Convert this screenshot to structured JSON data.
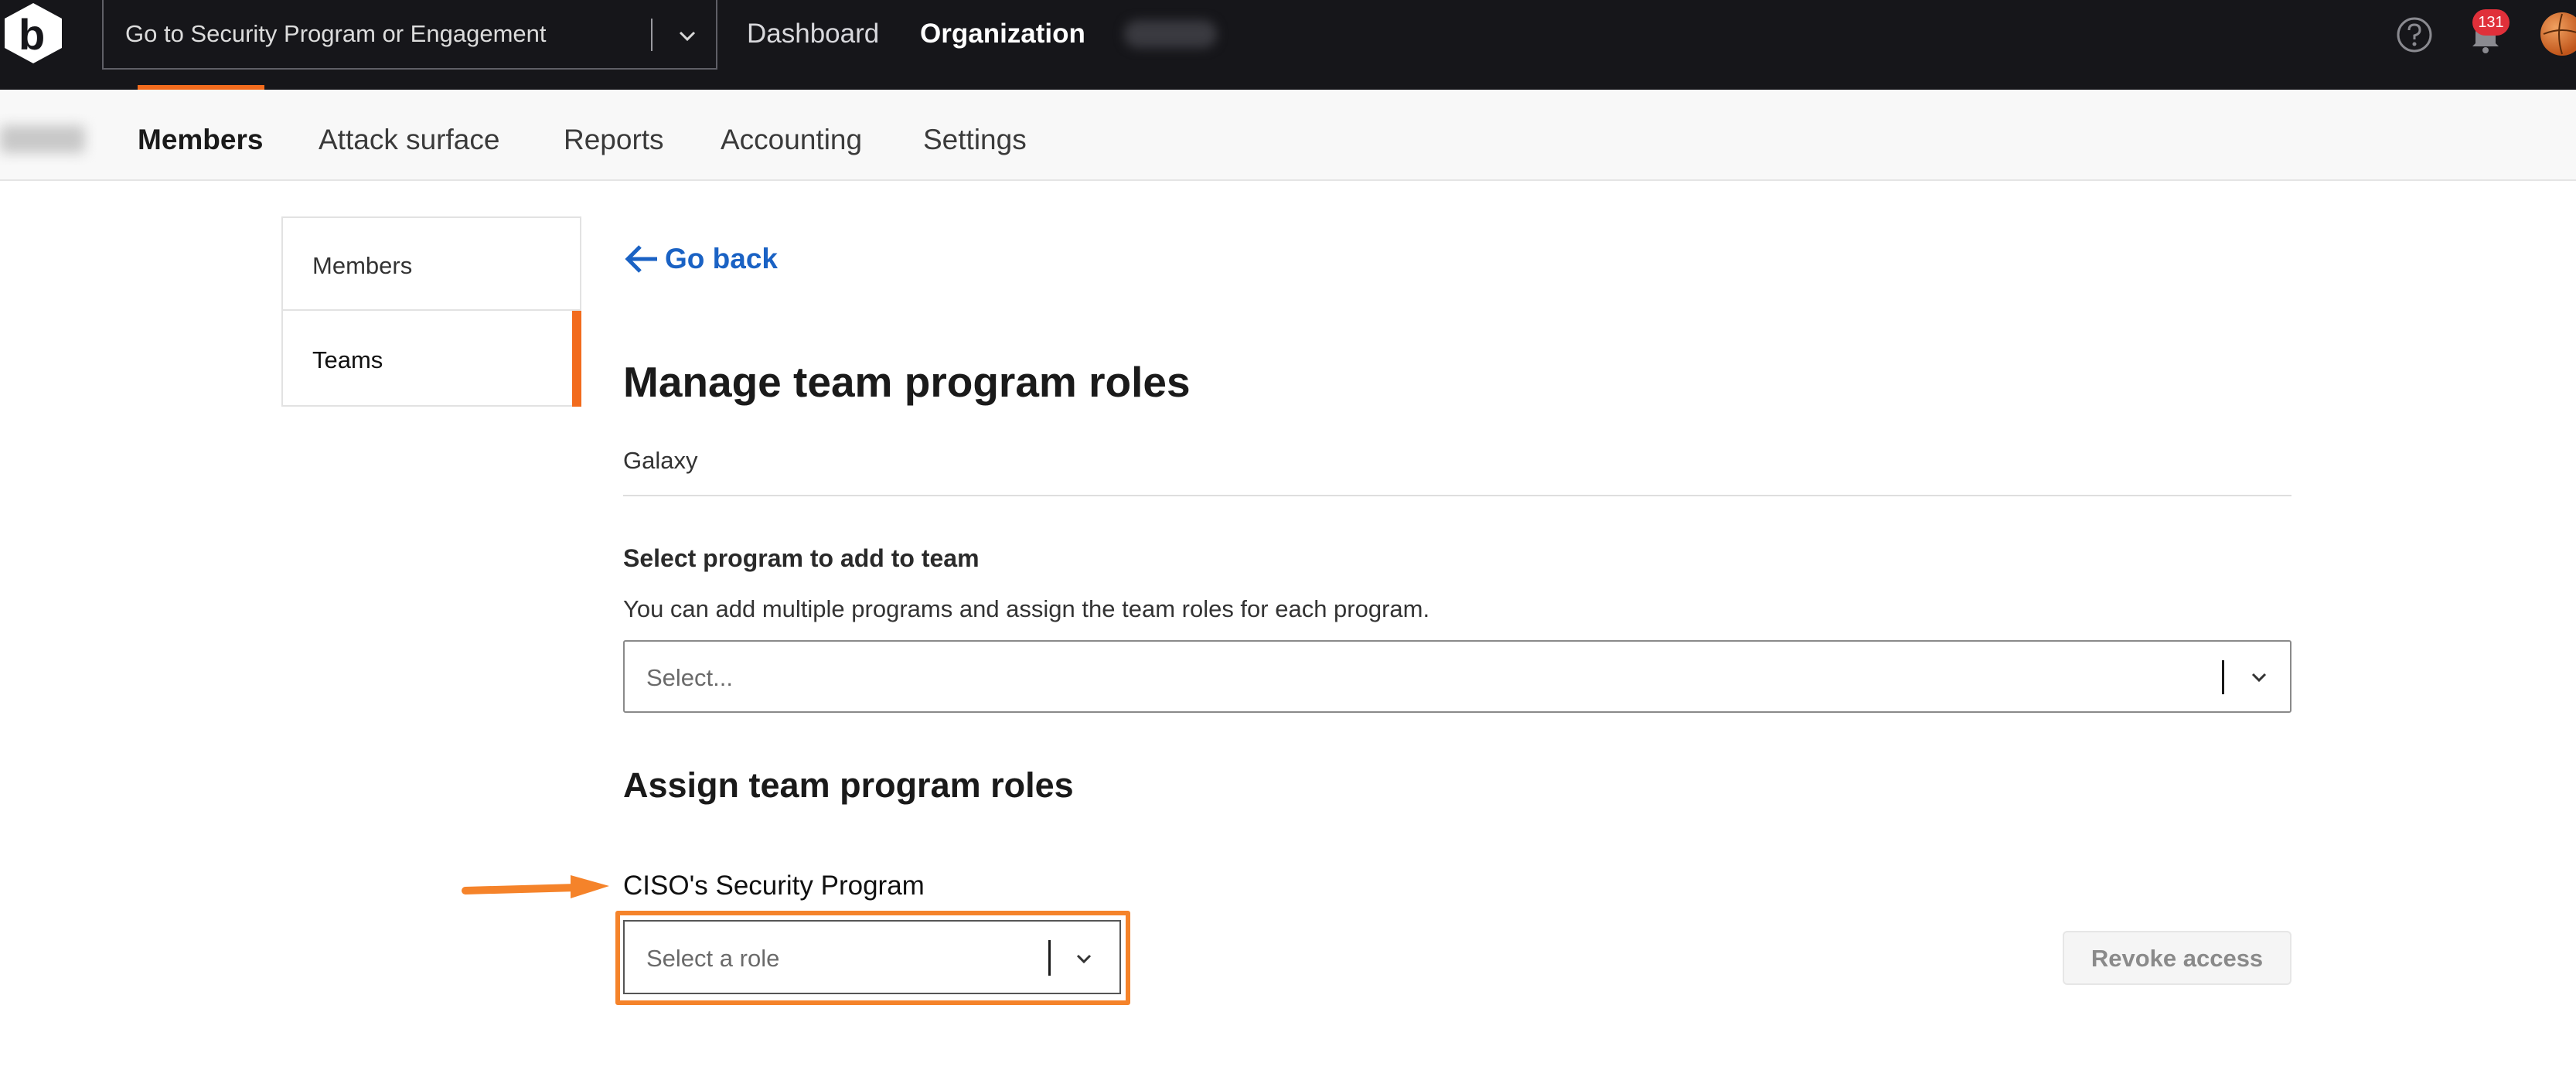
{
  "topbar": {
    "program_search_placeholder": "Go to Security Program or Engagement",
    "nav": {
      "dashboard": "Dashboard",
      "organization": "Organization"
    },
    "notification_count": "131",
    "icons": {
      "logo": "bugcrowd-logo-icon",
      "help": "help-circle-icon",
      "bell": "bell-icon",
      "avatar": "avatar-icon"
    }
  },
  "subnav": {
    "tabs": [
      "Members",
      "Attack surface",
      "Reports",
      "Accounting",
      "Settings"
    ],
    "active_tab": "Members"
  },
  "sidemenu": {
    "items": [
      "Members",
      "Teams"
    ],
    "active_item": "Teams"
  },
  "main": {
    "go_back": "Go back",
    "title": "Manage team program roles",
    "team_name": "Galaxy",
    "select_program": {
      "label": "Select program to add to team",
      "help": "You can add multiple programs and assign the team roles for each program.",
      "placeholder": "Select..."
    },
    "assign_title": "Assign team program roles",
    "program": {
      "name": "CISO's Security Program",
      "role_placeholder": "Select a role",
      "revoke_label": "Revoke access"
    }
  },
  "colors": {
    "topbar_bg": "#16161a",
    "accent": "#f26b1d",
    "link": "#1a62c4",
    "annotation": "#f5832a",
    "badge": "#e0303a"
  }
}
